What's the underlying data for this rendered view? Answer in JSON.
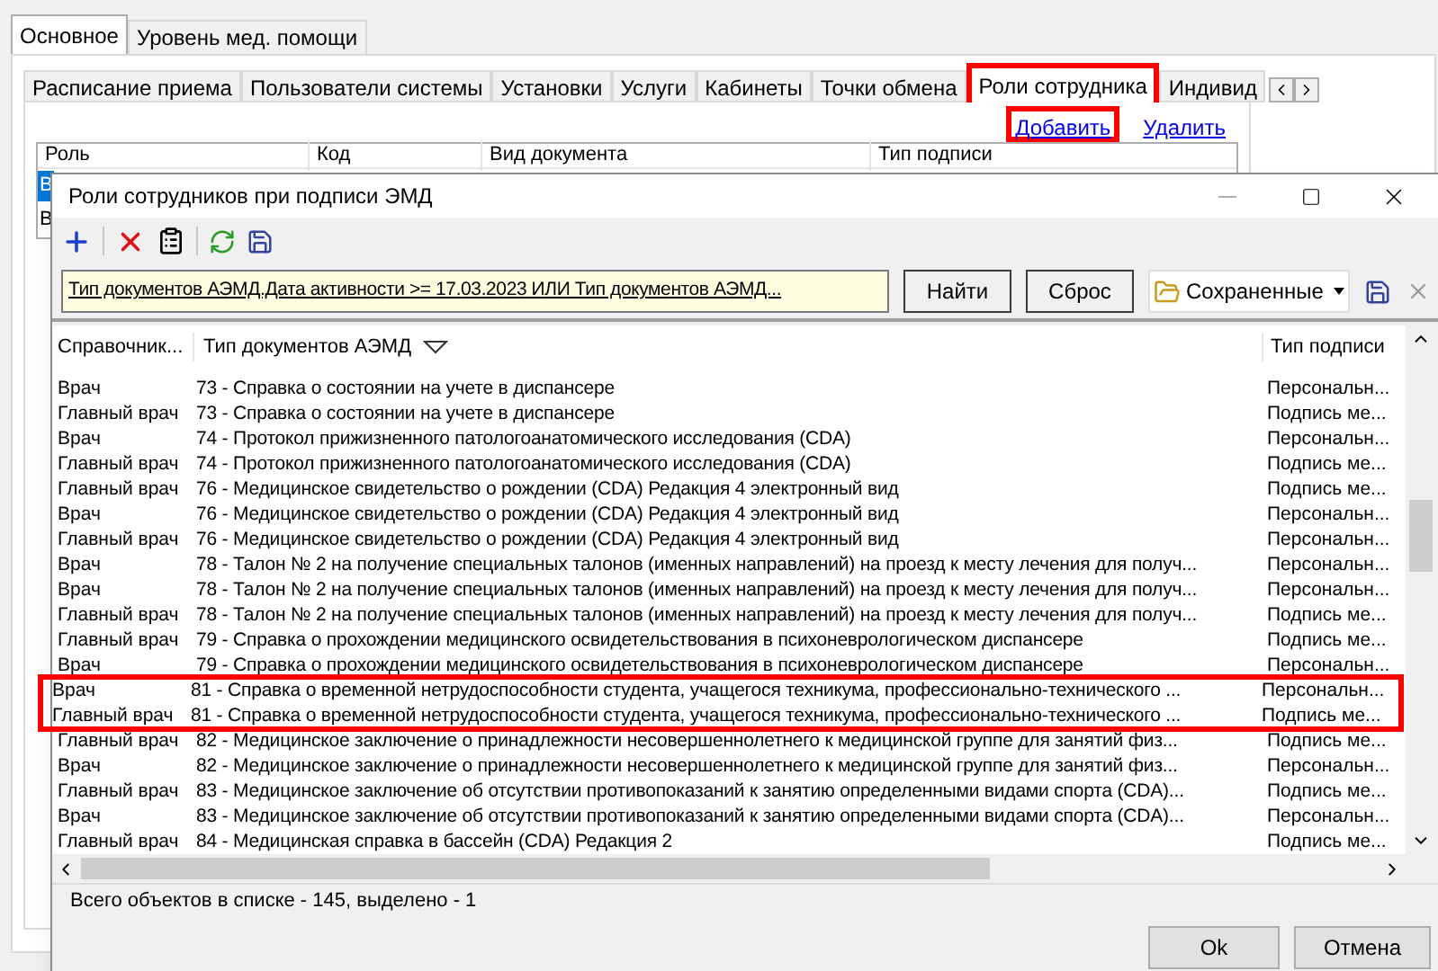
{
  "outer_tabs": [
    {
      "label": "Основное",
      "selected": true
    },
    {
      "label": "Уровень мед. помощи",
      "selected": false
    }
  ],
  "inner_tabs": [
    {
      "label": "Расписание приема",
      "selected": false,
      "highlighted": false
    },
    {
      "label": "Пользователи системы",
      "selected": false,
      "highlighted": false
    },
    {
      "label": "Установки",
      "selected": false,
      "highlighted": false
    },
    {
      "label": "Услуги",
      "selected": false,
      "highlighted": false
    },
    {
      "label": "Кабинеты",
      "selected": false,
      "highlighted": false
    },
    {
      "label": "Точки обмена",
      "selected": false,
      "highlighted": false
    },
    {
      "label": "Роли сотрудника",
      "selected": true,
      "highlighted": true
    },
    {
      "label": "Индивид",
      "selected": false,
      "highlighted": false
    }
  ],
  "links": [
    {
      "label": "Добавить",
      "highlighted": true
    },
    {
      "label": "Удалить",
      "highlighted": false
    }
  ],
  "background_table": {
    "columns": [
      "Роль",
      "Код",
      "Вид документа",
      "Тип подписи"
    ],
    "rows": [
      {
        "text": "В",
        "selected": true
      },
      {
        "text": "В",
        "selected": false
      }
    ]
  },
  "dialog": {
    "title": "Роли сотрудников при подписи ЭМД",
    "filter": "Тип документов АЭМД.Дата активности >= 17.03.2023 ИЛИ Тип документов АЭМД...",
    "buttons": [
      "Найти",
      "Сброс"
    ],
    "saved": "Сохраненные",
    "columns": [
      {
        "label": "Справочник...",
        "sorted": false
      },
      {
        "label": "Тип документов АЭМД",
        "sorted": true
      },
      {
        "label": "Тип подписи",
        "sorted": false
      }
    ],
    "rows": [
      {
        "role": "Врач",
        "doc": "73 - Справка о состоянии на учете в диспансере",
        "sign": "Персональн...",
        "highlighted": false
      },
      {
        "role": "Главный врач",
        "doc": "73 - Справка о состоянии на учете в диспансере",
        "sign": "Подпись ме...",
        "highlighted": false
      },
      {
        "role": "Врач",
        "doc": "74 - Протокол прижизненного патологоанатомического исследования (CDA)",
        "sign": "Персональн...",
        "highlighted": false
      },
      {
        "role": "Главный врач",
        "doc": "74 - Протокол прижизненного патологоанатомического исследования (CDA)",
        "sign": "Подпись ме...",
        "highlighted": false
      },
      {
        "role": "Главный врач",
        "doc": "76 - Медицинское свидетельство о рождении (CDA) Редакция 4 электронный вид",
        "sign": "Подпись ме...",
        "highlighted": false
      },
      {
        "role": "Врач",
        "doc": "76 - Медицинское свидетельство о рождении (CDA) Редакция 4 электронный вид",
        "sign": "Персональн...",
        "highlighted": false
      },
      {
        "role": "Главный врач",
        "doc": "76 - Медицинское свидетельство о рождении (CDA) Редакция 4 электронный вид",
        "sign": "Персональн...",
        "highlighted": false
      },
      {
        "role": "Врач",
        "doc": "78 - Талон № 2 на получение специальных талонов (именных направлений) на проезд к месту лечения для получ...",
        "sign": "Персональн...",
        "highlighted": false
      },
      {
        "role": "Врач",
        "doc": "78 - Талон № 2 на получение специальных талонов (именных направлений) на проезд к месту лечения для получ...",
        "sign": "Персональн...",
        "highlighted": false
      },
      {
        "role": "Главный врач",
        "doc": "78 - Талон № 2 на получение специальных талонов (именных направлений) на проезд к месту лечения для получ...",
        "sign": "Подпись ме...",
        "highlighted": false
      },
      {
        "role": "Главный врач",
        "doc": "79 - Справка о прохождении медицинского освидетельствования в психоневрологическом диспансере",
        "sign": "Подпись ме...",
        "highlighted": false
      },
      {
        "role": "Врач",
        "doc": "79 - Справка о прохождении медицинского освидетельствования в психоневрологическом диспансере",
        "sign": "Персональн...",
        "highlighted": false
      },
      {
        "role": "Врач",
        "doc": "81 - Справка о временной нетрудоспособности студента, учащегося техникума, профессионально-технического ...",
        "sign": "Персональн...",
        "highlighted": true
      },
      {
        "role": "Главный врач",
        "doc": "81 - Справка о временной нетрудоспособности студента, учащегося техникума, профессионально-технического ...",
        "sign": "Подпись ме...",
        "highlighted": true
      },
      {
        "role": "Главный врач",
        "doc": "82 - Медицинское заключение о принадлежности несовершеннолетнего к медицинской группе для занятий физ...",
        "sign": "Подпись ме...",
        "highlighted": false
      },
      {
        "role": "Врач",
        "doc": "82 - Медицинское заключение о принадлежности несовершеннолетнего к медицинской группе для занятий физ...",
        "sign": "Персональн...",
        "highlighted": false
      },
      {
        "role": "Главный врач",
        "doc": "83 - Медицинское заключение об отсутствии противопоказаний к занятию определенными видами спорта (CDA)...",
        "sign": "Подпись ме...",
        "highlighted": false
      },
      {
        "role": "Врач",
        "doc": "83 - Медицинское заключение об отсутствии противопоказаний к занятию определенными видами спорта (CDA)...",
        "sign": "Персональн...",
        "highlighted": false
      },
      {
        "role": "Главный врач",
        "doc": "84 - Медицинская справка в бассейн (CDA) Редакция 2",
        "sign": "Подпись ме...",
        "highlighted": false
      }
    ],
    "status": "Всего объектов в списке - 145, выделено - 1",
    "ok": "Ok",
    "cancel": "Отмена"
  }
}
